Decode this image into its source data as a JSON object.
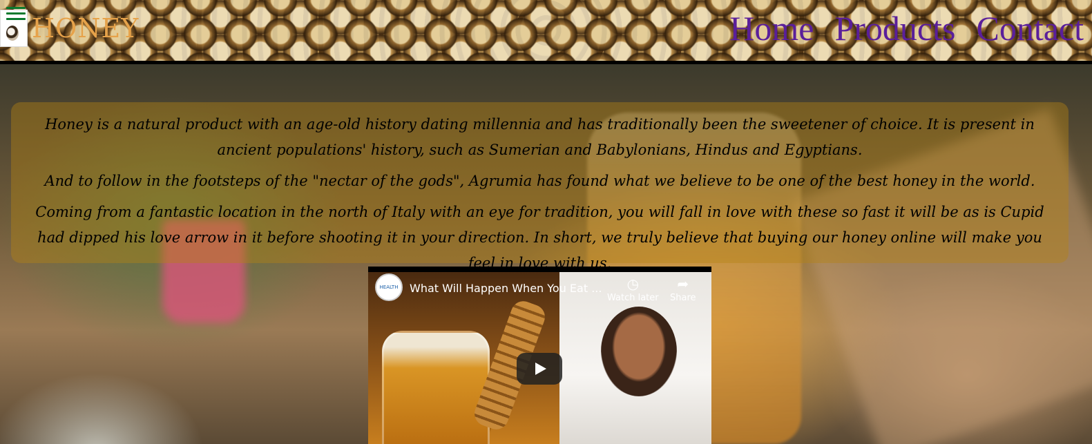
{
  "brand": {
    "name": "HONEY"
  },
  "nav": {
    "items": [
      "Home",
      "Products",
      "Contact"
    ]
  },
  "intro": {
    "paragraphs": [
      "Honey is a natural product with an age-old history dating millennia and has traditionally been the sweetener of choice. It is present in ancient populations' history, such as Sumerian and Babylonians, Hindus and Egyptians.",
      "And to follow in the footsteps of the \"nectar of the gods\", Agrumia has found what we believe to be one of the best honey in the world.",
      "Coming from a fantastic location in the north of Italy with an eye for tradition, you will fall in love with these so fast it will be as is Cupid had dipped his love arrow in it before shooting it in your direction. In short, we truly believe that buying our honey online will make you feel in love with us."
    ]
  },
  "video": {
    "title": "What Will Happen When You Eat ...",
    "channel_badge": "HEALTH NUTRITION",
    "watch_later_label": "Watch later",
    "share_label": "Share"
  },
  "colors": {
    "brand": "#e6a24a",
    "nav_link": "#5a1f9a",
    "intro_overlay": "rgba(180,130,20,0.42)",
    "menu_icon": "#0b7a2e"
  },
  "icons": {
    "menu": "hamburger-icon",
    "watch_later": "clock-icon",
    "share": "share-arrow-icon",
    "play": "play-icon"
  }
}
